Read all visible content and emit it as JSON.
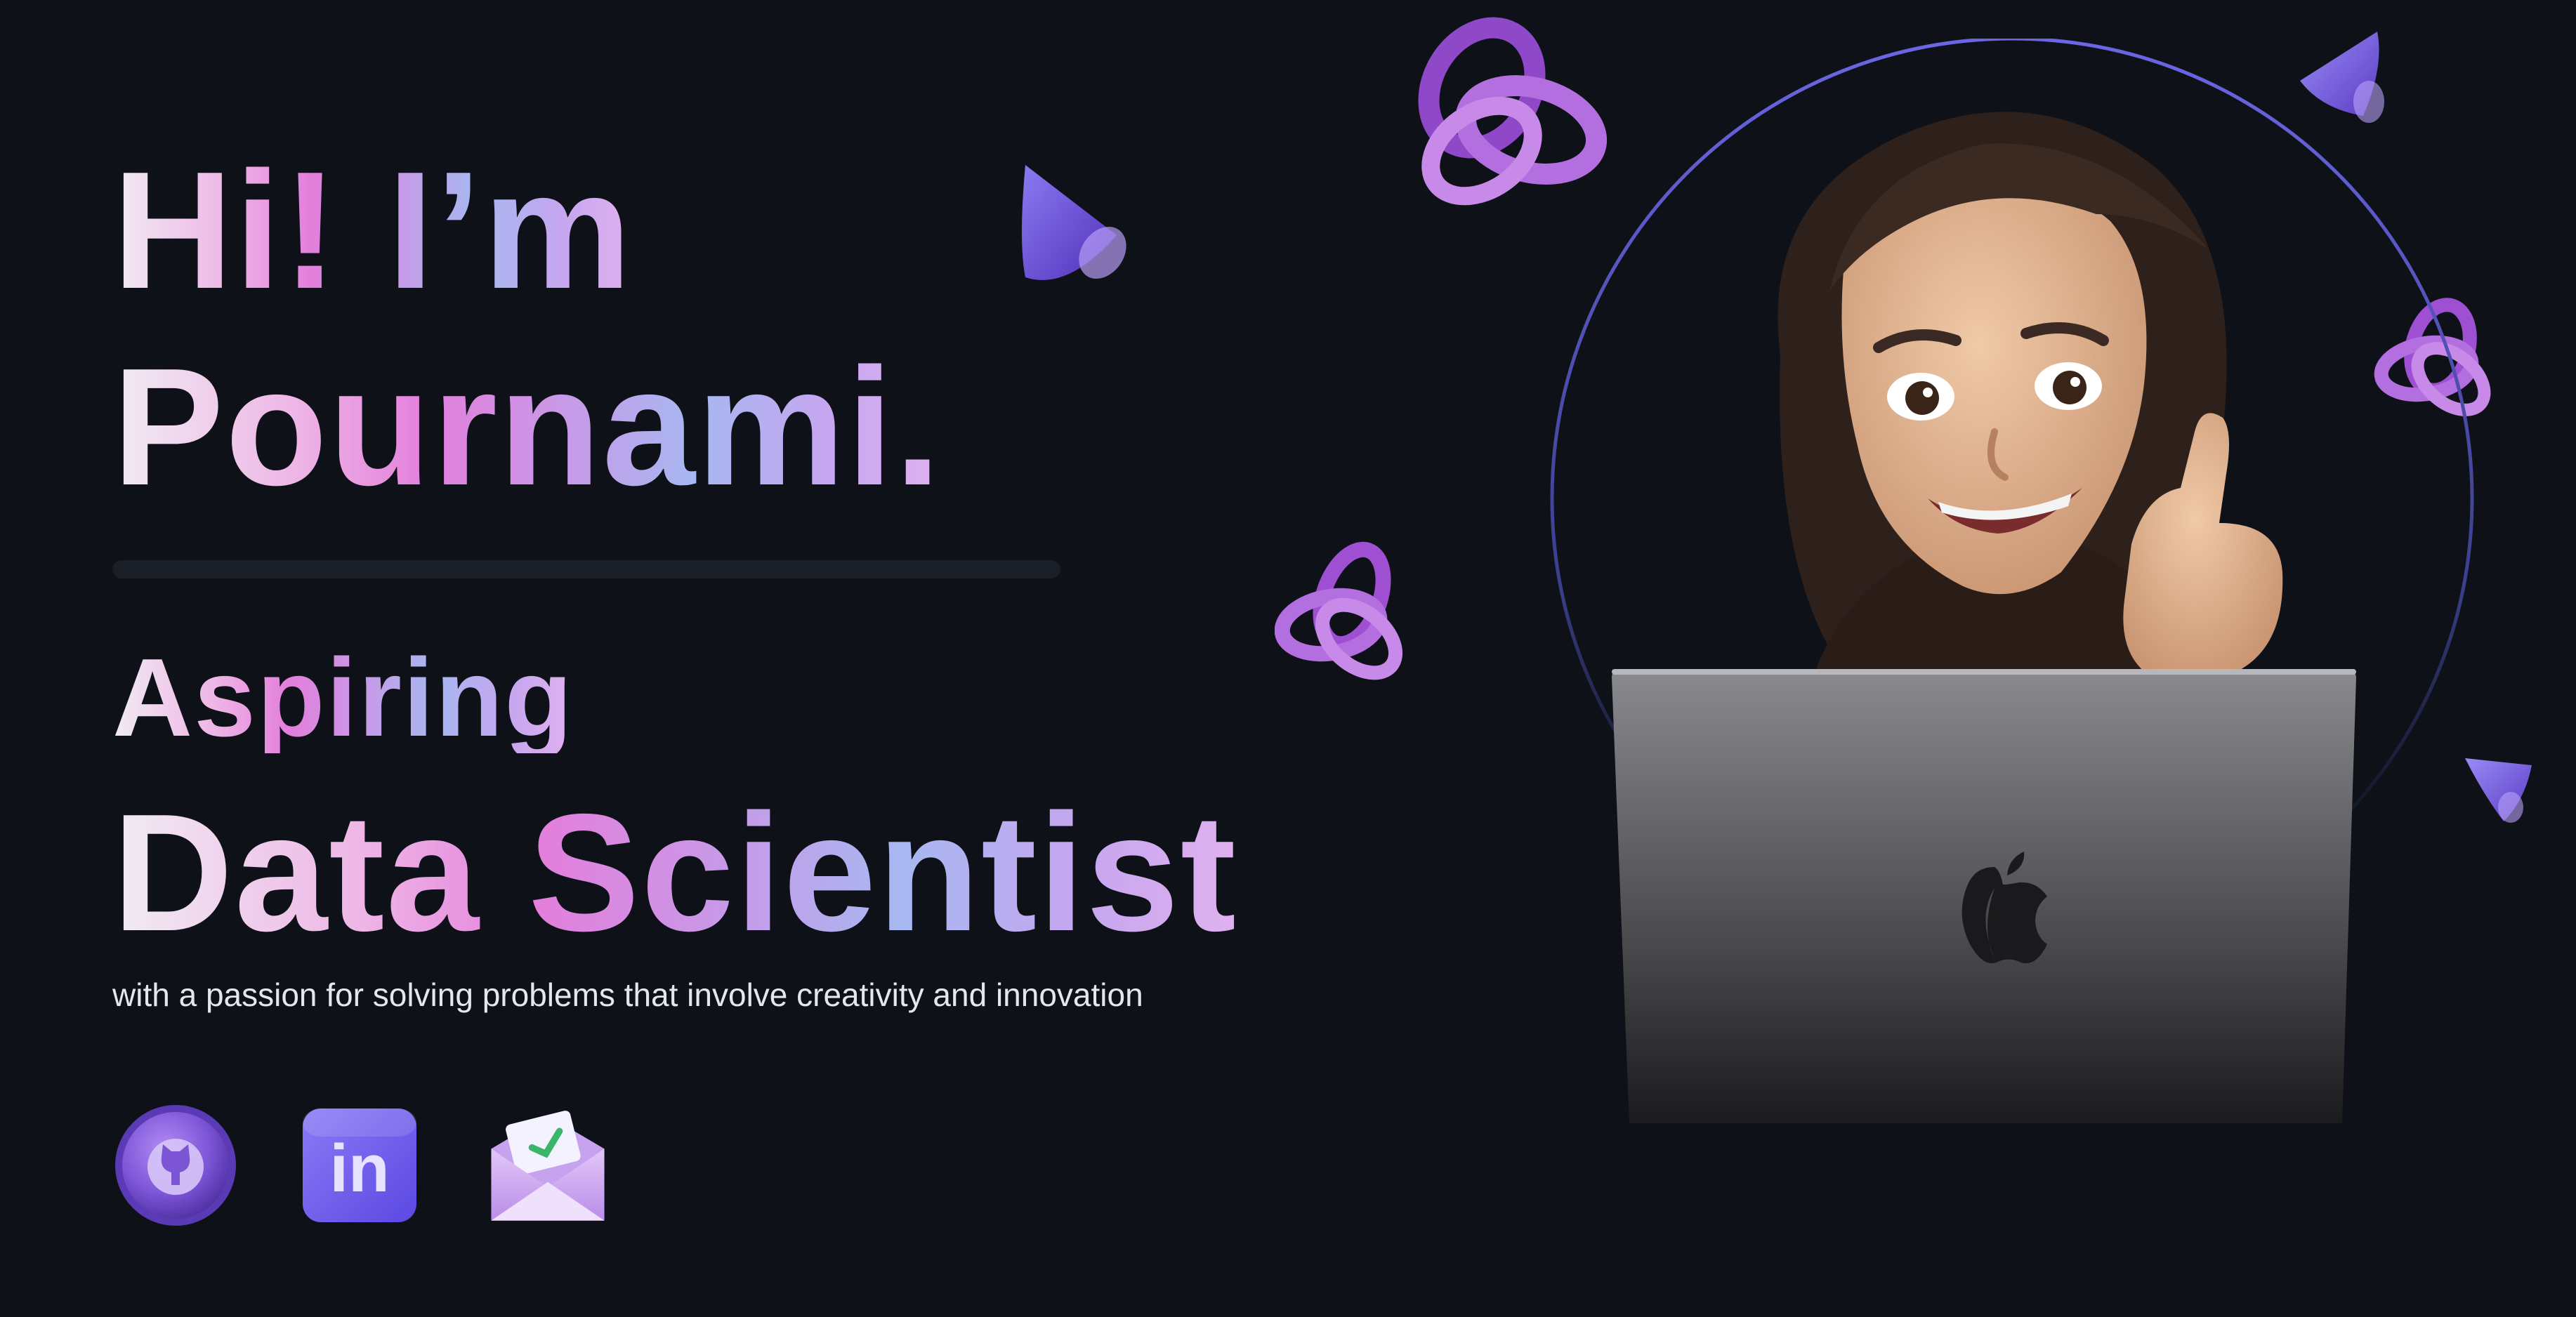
{
  "hero": {
    "greeting": "Hi! I’m",
    "name": "Pournami.",
    "aspiring": "Aspiring",
    "role": "Data Scientist",
    "tagline": "with a passion for solving problems that involve creativity and innovation"
  },
  "socials": [
    {
      "label": "GitHub",
      "icon": "github-icon"
    },
    {
      "label": "LinkedIn",
      "icon": "linkedin-icon",
      "text": "in"
    },
    {
      "label": "Email",
      "icon": "mail-icon"
    }
  ],
  "colors": {
    "background": "#0e1118",
    "accent_purple": "#a65fd6",
    "accent_pink": "#e37fdc",
    "accent_blue": "#a7b8f0",
    "ring": "#6c66e6"
  },
  "decorations": [
    "knot-icon",
    "cone-icon",
    "memoji-avatar",
    "laptop-icon",
    "apple-logo-icon"
  ]
}
